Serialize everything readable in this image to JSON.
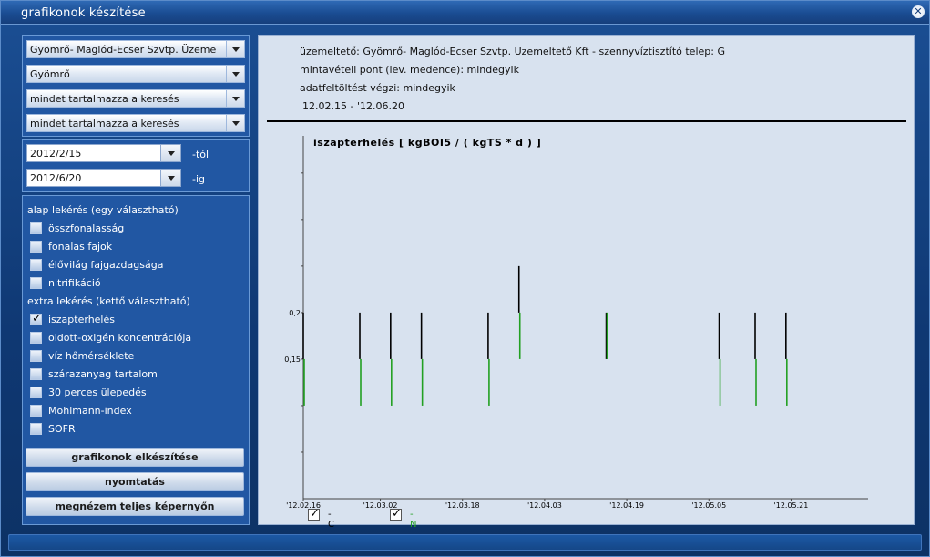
{
  "window": {
    "title": "grafikonok készítése"
  },
  "filters": {
    "operator": "Gyömrő- Maglód-Ecser Szvtp. Üzeme",
    "location": "Gyömrő",
    "search1": "mindet tartalmazza a keresés",
    "search2": "mindet tartalmazza a keresés"
  },
  "dates": {
    "from": "2012/2/15",
    "from_label": "-tól",
    "to": "2012/6/20",
    "to_label": "-ig"
  },
  "basic": {
    "label": "alap lekérés (egy választható)",
    "items": [
      {
        "label": "összfonalasság",
        "checked": false
      },
      {
        "label": "fonalas fajok",
        "checked": false
      },
      {
        "label": "élővilág fajgazdagsága",
        "checked": false
      },
      {
        "label": "nitrifikáció",
        "checked": false
      }
    ]
  },
  "extra": {
    "label": "extra lekérés (kettő választható)",
    "items": [
      {
        "label": "iszapterhelés",
        "checked": true
      },
      {
        "label": "oldott-oxigén koncentrációja",
        "checked": false
      },
      {
        "label": "víz hőmérséklete",
        "checked": false
      },
      {
        "label": "szárazanyag tartalom",
        "checked": false
      },
      {
        "label": "30 perces ülepedés",
        "checked": false
      },
      {
        "label": "Mohlmann-index",
        "checked": false
      },
      {
        "label": "SOFR",
        "checked": false
      }
    ]
  },
  "buttons": {
    "make": "grafikonok elkészítése",
    "print": "nyomtatás",
    "fullscreen": "megnézem teljes képernyőn"
  },
  "info": {
    "line1": "üzemeltető: Gyömrő- Maglód-Ecser Szvtp. Üzemeltető Kft - szennyvíztisztító telep: G",
    "line2": "mintavételi pont (lev. medence): mindegyik",
    "line3": "adatfeltöltést végzi: mindegyik",
    "line4": "'12.02.15 - '12.06.20"
  },
  "colors": {
    "series_c": "#000000",
    "series_n": "#22a022",
    "axis": "#444444"
  },
  "chart_data": {
    "type": "bar",
    "title": "iszapterhelés [ kgBOI5 / ( kgTS * d ) ]",
    "x_ticks": [
      "'12.02.16",
      "'12.03.02",
      "'12.03.18",
      "'12.04.03",
      "'12.04.19",
      "'12.05.05",
      "'12.05.21"
    ],
    "x_tick_days": [
      0,
      15,
      31,
      47,
      63,
      79,
      95
    ],
    "y_ticks": [
      "0,2",
      "0,15"
    ],
    "y_tick_values": [
      0.2,
      0.15
    ],
    "ylim": [
      0.0,
      0.39
    ],
    "series": [
      {
        "name": "C",
        "color": "#000000",
        "points": [
          {
            "day": 0,
            "low": 0.15,
            "high": 0.2
          },
          {
            "day": 11,
            "low": 0.15,
            "high": 0.2
          },
          {
            "day": 17,
            "low": 0.15,
            "high": 0.2
          },
          {
            "day": 23,
            "low": 0.15,
            "high": 0.2
          },
          {
            "day": 36,
            "low": 0.15,
            "high": 0.2
          },
          {
            "day": 42,
            "low": 0.2,
            "high": 0.25
          },
          {
            "day": 59,
            "low": 0.15,
            "high": 0.2
          },
          {
            "day": 81,
            "low": 0.15,
            "high": 0.2
          },
          {
            "day": 88,
            "low": 0.15,
            "high": 0.2
          },
          {
            "day": 94,
            "low": 0.15,
            "high": 0.2
          }
        ]
      },
      {
        "name": "N",
        "color": "#22a022",
        "points": [
          {
            "day": 0,
            "low": 0.1,
            "high": 0.15
          },
          {
            "day": 11,
            "low": 0.1,
            "high": 0.15
          },
          {
            "day": 17,
            "low": 0.1,
            "high": 0.15
          },
          {
            "day": 23,
            "low": 0.1,
            "high": 0.15
          },
          {
            "day": 36,
            "low": 0.1,
            "high": 0.15
          },
          {
            "day": 42,
            "low": 0.15,
            "high": 0.2
          },
          {
            "day": 59,
            "low": 0.15,
            "high": 0.2
          },
          {
            "day": 81,
            "low": 0.1,
            "high": 0.15
          },
          {
            "day": 88,
            "low": 0.1,
            "high": 0.15
          },
          {
            "day": 94,
            "low": 0.1,
            "high": 0.15
          }
        ]
      }
    ],
    "legend": [
      {
        "label": "- C",
        "checked": true,
        "color": "#000000"
      },
      {
        "label": "- N",
        "checked": true,
        "color": "#22a022"
      }
    ]
  }
}
